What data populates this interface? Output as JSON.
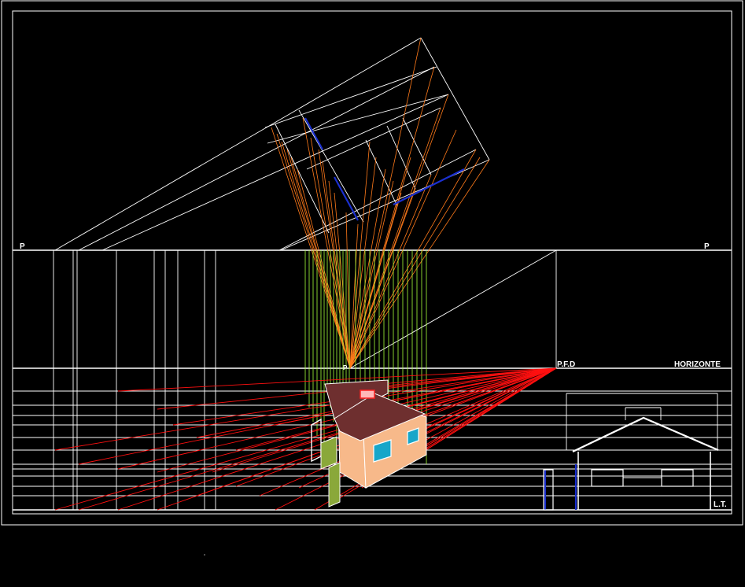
{
  "labels": {
    "p_left": "P",
    "p_right": "P",
    "pfd": "P.F.D",
    "horizonte": "HORIZONTE",
    "lt": "L.T.",
    "vp_mark": "P"
  },
  "colors": {
    "background": "#000000",
    "construction": "#ffffff",
    "projection_orange": "#ff7a1a",
    "projection_green": "#a6ff3a",
    "projection_red": "#ff1010",
    "wall": "#f7b98a",
    "roof": "#6e2f2f",
    "window": "#17a6c9",
    "fence": "#8aa83a",
    "blue_accent": "#1a2fd0"
  }
}
